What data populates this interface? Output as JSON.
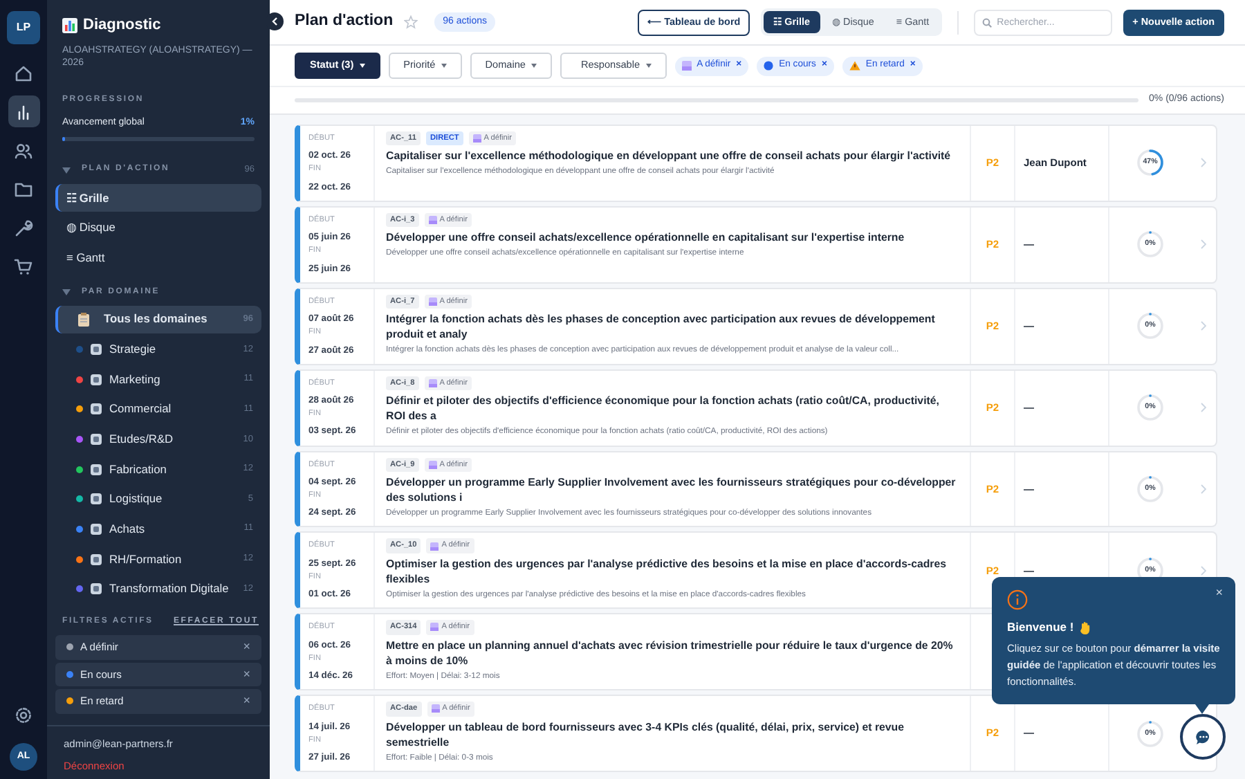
{
  "rail": {
    "logo": "LP",
    "avatar": "AL",
    "items": [
      {
        "kind": "home",
        "selected": false
      },
      {
        "kind": "chart",
        "selected": true
      },
      {
        "kind": "users",
        "selected": false
      },
      {
        "kind": "folder",
        "selected": false
      },
      {
        "kind": "wrench",
        "selected": false
      },
      {
        "kind": "cart",
        "selected": false
      }
    ]
  },
  "sidebar": {
    "title": "Diagnostic",
    "subtitle": "ALOAHSTRATEGY (ALOAHSTRATEGY) — 2026",
    "progress_heading": "PROGRESSION",
    "progress": {
      "label": "Avancement global",
      "value": "1%",
      "level": 0.01
    },
    "plan": {
      "heading": "PLAN D'ACTION",
      "count": "96",
      "expanded": true,
      "items": [
        {
          "label": "☷ Grille",
          "selected": true
        },
        {
          "label": "◍ Disque",
          "selected": false
        },
        {
          "label": "≡ Gantt",
          "selected": false
        }
      ]
    },
    "domains": {
      "heading": "PAR DOMAINE",
      "expanded": true,
      "items": [
        {
          "kind": "all",
          "label": "Tous les domaines",
          "count": "96",
          "selected": true
        },
        {
          "kind": "domain",
          "label": "Strategie",
          "count": "12",
          "color": "#1e4f8a",
          "selected": false
        },
        {
          "kind": "domain",
          "label": "Marketing",
          "count": "11",
          "color": "#ef4444",
          "selected": false
        },
        {
          "kind": "domain",
          "label": "Commercial",
          "count": "11",
          "color": "#f59e0b",
          "selected": false
        },
        {
          "kind": "domain",
          "label": "Etudes/R&D",
          "count": "10",
          "color": "#a855f7",
          "selected": false
        },
        {
          "kind": "domain",
          "label": "Fabrication",
          "count": "12",
          "color": "#22c55e",
          "selected": false
        },
        {
          "kind": "domain",
          "label": "Logistique",
          "count": "5",
          "color": "#14b8a6",
          "selected": false
        },
        {
          "kind": "domain",
          "label": "Achats",
          "count": "11",
          "color": "#3b82f6",
          "selected": false
        },
        {
          "kind": "domain",
          "label": "RH/Formation",
          "count": "12",
          "color": "#f97316",
          "selected": false
        },
        {
          "kind": "domain",
          "label": "Transformation Digitale",
          "count": "12",
          "color": "#6366f1",
          "selected": false
        }
      ]
    },
    "filters": {
      "heading": "FILTRES ACTIFS",
      "clear": "EFFACER TOUT",
      "items": [
        {
          "label": "A définir",
          "color": "#9ca3af",
          "remove": "×"
        },
        {
          "label": "En cours",
          "color": "#3b82f6",
          "remove": "×"
        },
        {
          "label": "En retard",
          "color": "#f59e0b",
          "remove": "×"
        }
      ]
    },
    "user_email": "admin@lean-partners.fr",
    "logout": "Déconnexion"
  },
  "header": {
    "title": "Plan d'action",
    "count_badge": "96 actions",
    "back_button": "⟵ Tableau de bord",
    "views": [
      {
        "label": "☷ Grille",
        "selected": true
      },
      {
        "label": "◍ Disque",
        "selected": false
      },
      {
        "label": "≡ Gantt",
        "selected": false
      }
    ],
    "search": {
      "placeholder": "Rechercher..."
    },
    "new_button": "+ Nouvelle action"
  },
  "filter_bar": {
    "dropdowns": [
      {
        "label": "Statut (3)",
        "selected": true
      },
      {
        "label": "Priorité",
        "selected": false
      },
      {
        "label": "Domaine",
        "selected": false
      },
      {
        "label": "Responsable",
        "selected": false
      }
    ],
    "chips": [
      {
        "kind": "undefined",
        "label": "A définir",
        "remove": "×"
      },
      {
        "kind": "progress",
        "label": "En cours",
        "remove": "×"
      },
      {
        "kind": "late",
        "label": "En retard",
        "remove": "×"
      }
    ]
  },
  "overall": {
    "text": "0% (0/96 actions)",
    "level": 0
  },
  "actions": [
    {
      "start_label": "DÉBUT",
      "start": "02 oct. 26",
      "end_label": "FIN",
      "end": "22 oct. 26",
      "code": "AC-_11",
      "direct": "DIRECT",
      "status": "A définir",
      "title": "Capitaliser sur l'excellence méthodologique en développant une offre de conseil achats pour élargir l'activité",
      "description": "Capitaliser sur l'excellence méthodologique en développant une offre de conseil achats pour élargir l'activité",
      "priority": "P2",
      "owner": "Jean Dupont",
      "progress": {
        "label": "47%",
        "level": 0.47
      },
      "chevron": true
    },
    {
      "start_label": "DÉBUT",
      "start": "05 juin 26",
      "end_label": "FIN",
      "end": "25 juin 26",
      "code": "AC-i_3",
      "status": "A définir",
      "title": "Développer une offre conseil achats/excellence opérationnelle en capitalisant sur l'expertise interne",
      "description": "Développer une offre conseil achats/excellence opérationnelle en capitalisant sur l'expertise interne",
      "priority": "P2",
      "owner": "—",
      "progress": {
        "label": "0%",
        "level": 0
      },
      "chevron": true
    },
    {
      "start_label": "DÉBUT",
      "start": "07 août 26",
      "end_label": "FIN",
      "end": "27 août 26",
      "code": "AC-i_7",
      "status": "A définir",
      "title": "Intégrer la fonction achats dès les phases de conception avec participation aux revues de développement produit et analy",
      "description": "Intégrer la fonction achats dès les phases de conception avec participation aux revues de développement produit et analyse de la valeur coll...",
      "priority": "P2",
      "owner": "—",
      "progress": {
        "label": "0%",
        "level": 0
      },
      "chevron": true
    },
    {
      "start_label": "DÉBUT",
      "start": "28 août 26",
      "end_label": "FIN",
      "end": "03 sept. 26",
      "code": "AC-i_8",
      "status": "A définir",
      "title": "Définir et piloter des objectifs d'efficience économique pour la fonction achats (ratio coût/CA, productivité, ROI des a",
      "description": "Définir et piloter des objectifs d'efficience économique pour la fonction achats (ratio coût/CA, productivité, ROI des actions)",
      "priority": "P2",
      "owner": "—",
      "progress": {
        "label": "0%",
        "level": 0
      },
      "chevron": true
    },
    {
      "start_label": "DÉBUT",
      "start": "04 sept. 26",
      "end_label": "FIN",
      "end": "24 sept. 26",
      "code": "AC-i_9",
      "status": "A définir",
      "title": "Développer un programme Early Supplier Involvement avec les fournisseurs stratégiques pour co-développer des solutions i",
      "description": "Développer un programme Early Supplier Involvement avec les fournisseurs stratégiques pour co-développer des solutions innovantes",
      "priority": "P2",
      "owner": "—",
      "progress": {
        "label": "0%",
        "level": 0
      },
      "chevron": true
    },
    {
      "start_label": "DÉBUT",
      "start": "25 sept. 26",
      "end_label": "FIN",
      "end": "01 oct. 26",
      "code": "AC-_10",
      "status": "A définir",
      "title": "Optimiser la gestion des urgences par l'analyse prédictive des besoins et la mise en place d'accords-cadres flexibles",
      "description": "Optimiser la gestion des urgences par l'analyse prédictive des besoins et la mise en place d'accords-cadres flexibles",
      "priority": "P2",
      "owner": "—",
      "progress": {
        "label": "0%",
        "level": 0
      },
      "chevron": true
    },
    {
      "start_label": "DÉBUT",
      "start": "06 oct. 26",
      "end_label": "FIN",
      "end": "14 déc. 26",
      "code": "AC-314",
      "status": "A définir",
      "title": "Mettre en place un planning annuel d'achats avec révision trimestrielle pour réduire le taux d'urgence de 20% à moins de 10%",
      "description": "Effort: Moyen | Délai: 3-12 mois"
    },
    {
      "start_label": "DÉBUT",
      "start": "14 juil. 26",
      "end_label": "FIN",
      "end": "27 juil. 26",
      "code": "AC-dae",
      "status": "A définir",
      "title": "Développer un tableau de bord fournisseurs avec 3-4 KPIs clés (qualité, délai, prix, service) et revue semestrielle",
      "description": "Effort: Faible | Délai: 0-3 mois",
      "priority": "P2",
      "owner": "—",
      "progress": {
        "label": "0%",
        "level": 0
      }
    }
  ],
  "welcome": {
    "title": "Bienvenue !",
    "text": "Cliquez sur ce bouton pour **démarrer la visite guidée** de l'application et découvrir toutes les fonctionnalités.",
    "close": "×"
  }
}
